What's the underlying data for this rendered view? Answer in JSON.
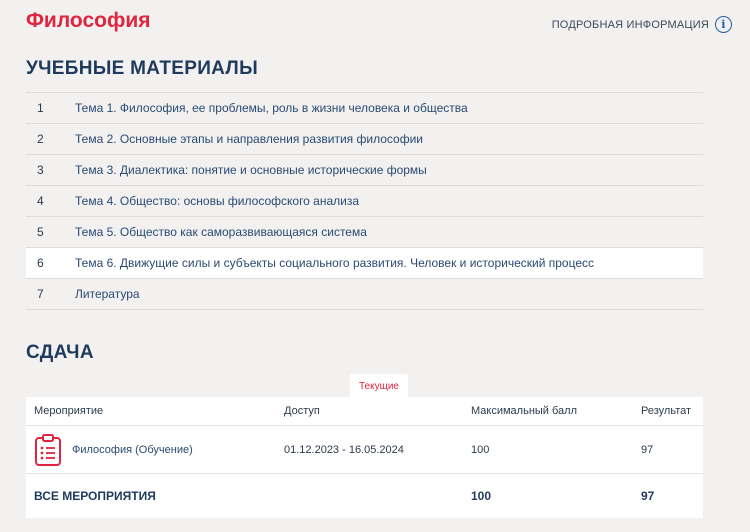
{
  "header": {
    "title": "Философия",
    "more_info": "ПОДРОБНАЯ ИНФОРМАЦИЯ"
  },
  "materials": {
    "title": "УЧЕБНЫЕ МАТЕРИАЛЫ",
    "items": [
      {
        "num": "1",
        "label": "Тема 1. Философия, ее проблемы, роль в жизни человека и общества"
      },
      {
        "num": "2",
        "label": "Тема 2. Основные этапы и направления развития философии"
      },
      {
        "num": "3",
        "label": "Тема 3. Диалектика: понятие и основные исторические формы"
      },
      {
        "num": "4",
        "label": "Тема 4. Общество: основы философского анализа"
      },
      {
        "num": "5",
        "label": "Тема 5. Общество как саморазвивающаяся система"
      },
      {
        "num": "6",
        "label": "Тема 6. Движущие силы и субъекты социального развития. Человек и исторический процесс"
      },
      {
        "num": "7",
        "label": "Литература"
      }
    ]
  },
  "exams": {
    "title": "СДАЧА",
    "tab": "Текущие",
    "columns": [
      "Мероприятие",
      "Доступ",
      "Максимальный балл",
      "Результат"
    ],
    "rows": [
      {
        "name": "Философия (Обучение)",
        "access": "01.12.2023 - 16.05.2024",
        "max": "100",
        "result": "97"
      }
    ],
    "total": {
      "label": "ВСЕ МЕРОПРИЯТИЯ",
      "max": "100",
      "result": "97"
    }
  },
  "colors": {
    "accent": "#e0253f",
    "heading": "#1e3a5c",
    "link": "#2a4a72"
  }
}
